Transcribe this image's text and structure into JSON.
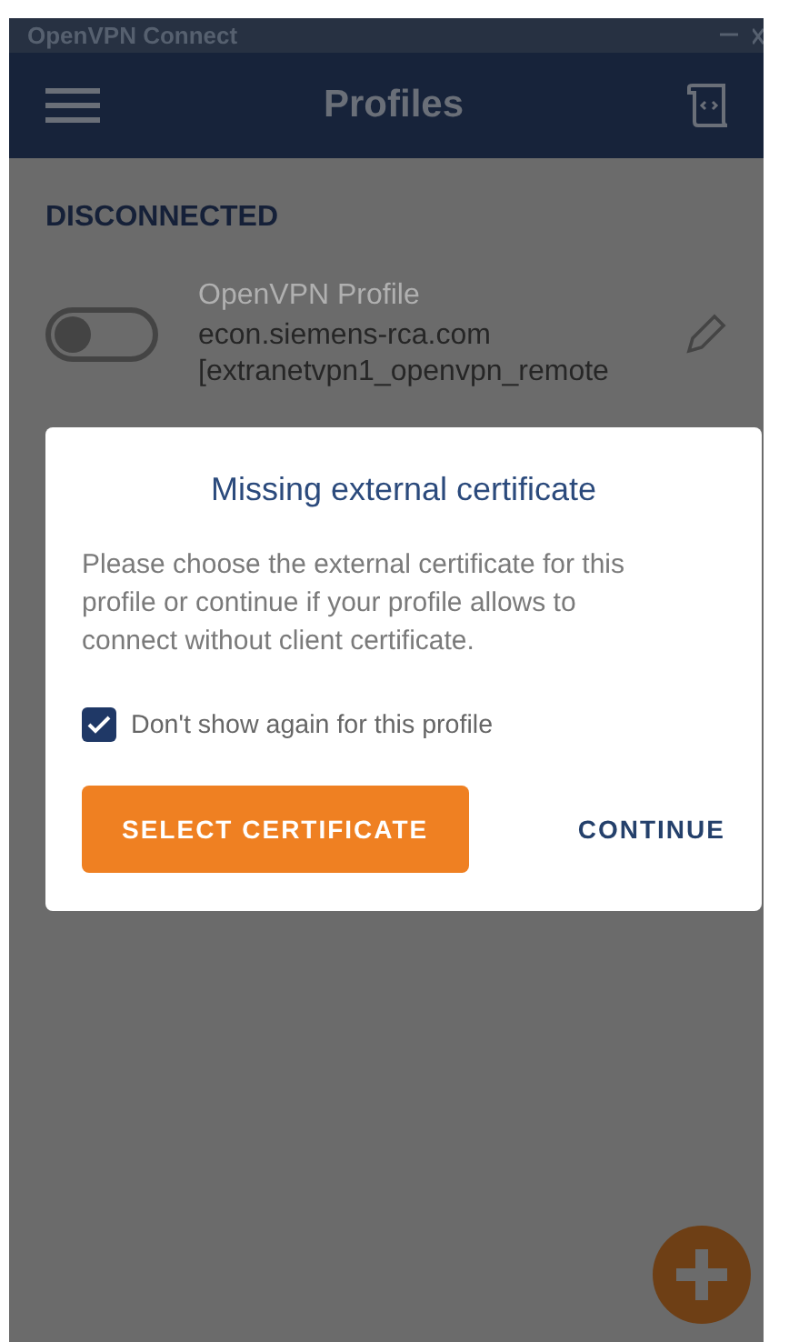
{
  "window": {
    "title": "OpenVPN Connect"
  },
  "header": {
    "title": "Profiles"
  },
  "status": "DISCONNECTED",
  "profiles": [
    {
      "name": "OpenVPN Profile",
      "server": "econ.siemens-rca.com",
      "details": "[extranetvpn1_openvpn_remote",
      "on": false
    }
  ],
  "dialog": {
    "title": "Missing external certificate",
    "message": "Please choose the external certificate for this profile or continue if your profile allows to connect without client certificate.",
    "checkbox": {
      "label": "Don't show again for this profile",
      "checked": true
    },
    "buttons": [
      {
        "label": "SELECT CERTIFICATE",
        "kind": "primary"
      },
      {
        "label": "CONTINUE",
        "kind": "text"
      }
    ]
  }
}
